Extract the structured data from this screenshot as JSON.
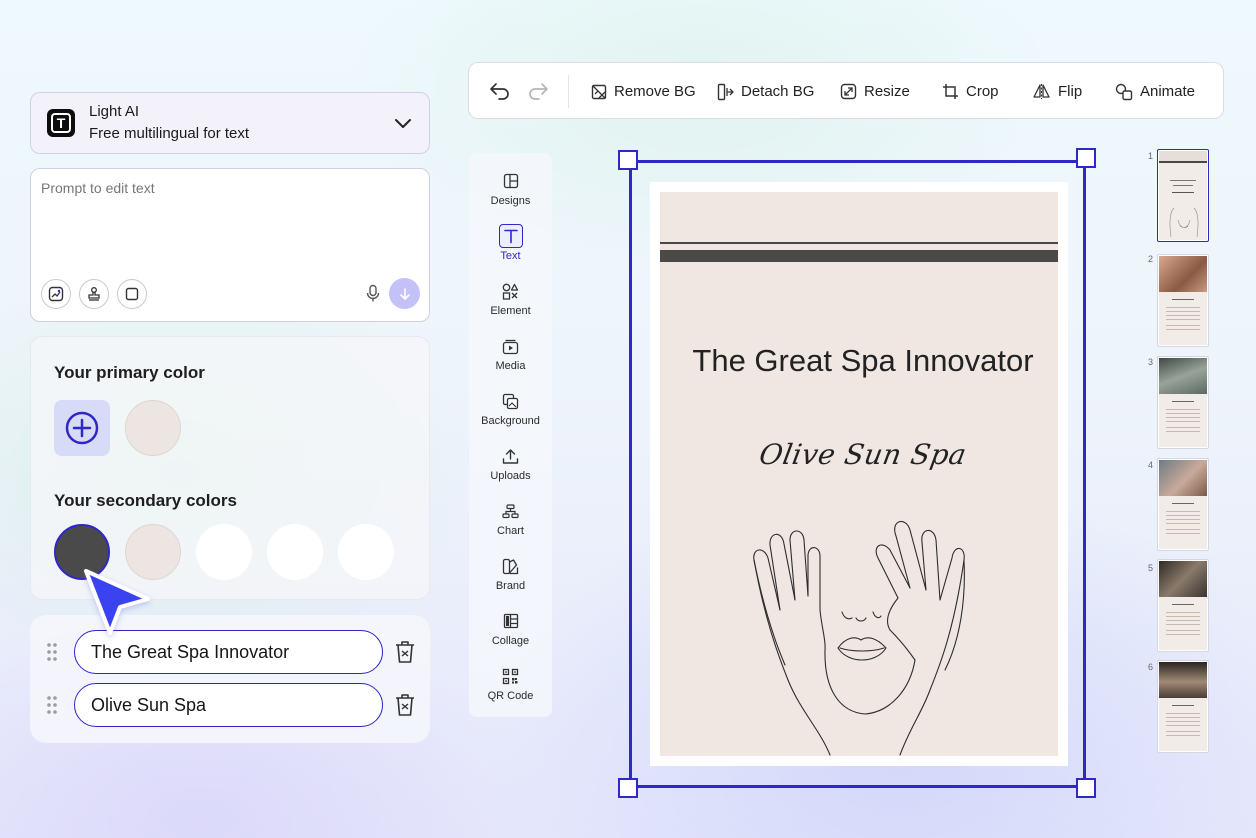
{
  "model_selector": {
    "name": "Light AI",
    "description": "Free multilingual for text",
    "logo_letter": "T"
  },
  "prompt": {
    "placeholder": "Prompt to edit text"
  },
  "colors": {
    "primary_title": "Your primary color",
    "primary": [
      "#ede5e1"
    ],
    "secondary_title": "Your secondary colors",
    "secondary": [
      "#4a4a4a",
      "#ede5e1",
      "#ffffff",
      "#ffffff",
      "#ffffff"
    ]
  },
  "text_items": [
    {
      "value": "The Great Spa Innovator"
    },
    {
      "value": "Olive Sun Spa"
    }
  ],
  "toolbar": {
    "remove_bg": "Remove BG",
    "detach_bg": "Detach BG",
    "resize": "Resize",
    "crop": "Crop",
    "flip": "Flip",
    "animate": "Animate"
  },
  "sidebar": [
    {
      "label": "Designs",
      "icon": "layout-icon"
    },
    {
      "label": "Text",
      "icon": "text-icon",
      "active": true
    },
    {
      "label": "Element",
      "icon": "shapes-icon"
    },
    {
      "label": "Media",
      "icon": "media-icon"
    },
    {
      "label": "Background",
      "icon": "background-icon"
    },
    {
      "label": "Uploads",
      "icon": "upload-icon"
    },
    {
      "label": "Chart",
      "icon": "chart-icon"
    },
    {
      "label": "Brand",
      "icon": "brand-icon"
    },
    {
      "label": "Collage",
      "icon": "collage-icon"
    },
    {
      "label": "QR Code",
      "icon": "qr-code-icon"
    }
  ],
  "canvas": {
    "title": "The Great Spa Innovator",
    "subtitle": "Olive Sun Spa",
    "background": "#f0e7e3",
    "accent": "#4a4948",
    "selection_color": "#2f27c8"
  },
  "pages": [
    {
      "number": "1"
    },
    {
      "number": "2"
    },
    {
      "number": "3"
    },
    {
      "number": "4"
    },
    {
      "number": "5"
    },
    {
      "number": "6"
    }
  ]
}
